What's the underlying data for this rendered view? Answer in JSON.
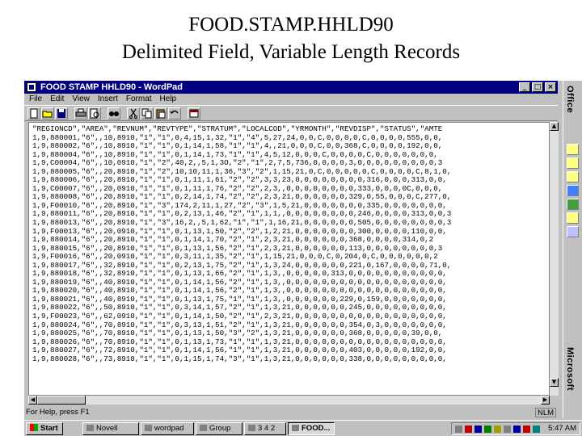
{
  "slide": {
    "title_line1": "FOOD.STAMP.HHLD90",
    "title_line2": "Delimited Field, Variable Length Records"
  },
  "window": {
    "title": "FOOD STAMP HHLD90 - WordPad",
    "minimize": "_",
    "maximize": "□",
    "close": "×"
  },
  "menu": [
    "File",
    "Edit",
    "View",
    "Insert",
    "Format",
    "Help"
  ],
  "toolbar_icons": [
    "new-icon",
    "open-icon",
    "save-icon",
    "print-icon",
    "print-preview-icon",
    "find-icon",
    "cut-icon",
    "copy-icon",
    "paste-icon",
    "undo-icon",
    "date-time-icon"
  ],
  "document_lines": [
    "\"REGIONCD\",\"AREA\",\"REVNUM\",\"REVTYPE\",\"STRATUM\",\"LOCALCOD\",\"YRMONTH\",\"REVDISP\",\"STATUS\",\"AMTE",
    "1,9,880001,\"6\",,10,8910,\"1\",\"1\",0,4,15,1,32,\"1\",\"4\",5,27,24,0,0,C,0,0,0,0,C,0,0,0,0,555,0,0,",
    "1,9,880002,\"6\",,10,8910,\"1\",\"1\",0,1,14,1,58,\"1\",\"1\",4,,21,0,0,0,C,0,0,368,C,0,0,0,0,192,0,0,",
    "1,9,880004,\"6\",,10,8910,\"1\",\"1\",0,1,14,1,73,\"1\",\"1\",4,5,12,0,0,0,C,0,0,0,0,C,0,0,0,0,0,0,0,",
    "1,9,C00004,\"6\",,10,0910,\"1\",\"2\",40,2,,5,1,3O,\"2\",\"1\",2,7,5,736,0,0,0,0,3,0,0,0,0,0,0,0,0,0,3",
    "1,9,880005,\"6\",,20,8910,\"1\",\"2\",10,10,11,1,36,\"3\",\"2\",1,15,21,0,C,0,0,0,0,0,C,0,0,0,0,C,8,1,0,",
    "1,9,880006,\"6\",,20,8910,\"1\",\"1\",0,1,11,1,61,\"2\",\"2\",3,3,23,0,0,0,0,0,0,0,0,316,0,0,0,313,0,0,",
    "1,9,C00007,\"6\",,20,0910,\"1\",\"1\",0,1,11,1,76,\"2\",\"2\",2,3,,0,0,0,0,0,0,0,0,333,0,0,0,0C,0,0,0,",
    "1,9,880008,\"6\",,20,8910,\"1\",\"1\",0,2,14,1,74,\"2\",\"2\",2,3,21,0,0,0,0,0,0,329,0,55,0,0,0,C,277,0,",
    "1,9,F00010,\"6\",,20,8910,\"1\",\"3\",174,2,11,1,27,\"2\",\"3\",1,5,21,0,0,0,0,0,0,0,335,0,0,0,0,0,0,0,",
    "1,9,880011,\"6\",,20,8910,\"1\",\"1\",0,2,13,1,46,\"2\",\"1\",1,1,,0,0,0,0,0,0,0,0,246,0,0,0,0,313,0,0,3",
    "1,9,880013,\"6\",,20,8910,\"1\",\"3\",16,2,,5,1,62,\"1\",\"1\",1,16,21,0,0,0,0,0,0,505,0,0,0,0,0,0,0,0,3",
    "1,9,F00013,\"6\",,20,0910,\"1\",\"1\",0,1,13,1,50,\"2\",\"2\",1,2,21,0,0,0,0,0,0,0,300,0,0,0,0,110,0,0,",
    "1,9,880014,\"6\",,20,8910,\"1\",\"1\",0,1,14,1,70,\"2\",\"1\",2,3,21,0,0,0,0,0,0,368,0,0,0,0,314,0,2",
    "1,9,880015,\"6\",,20,8910,\"1\",\"1\",0,1,13,1,56,\"2\",\"1\",2,3,21,0,0,0,0,0,0,113,0,0,0,0,0,0,0,0,3",
    "1,9,F00016,\"6\",,20,0910,\"1\",\"1\",0,3,11,1,35,\"2\",\"1\",1,15,21,0,0,0,C,0,204,0,C,0,0,0,0,0,0,2",
    "1,9,880017,\"6\",,32,8910,\"1\",\"1\",0,2,13,1,75,\"2\",\"1\",1,3,24,0,0,0,0,0,0,221,0,167,0,0,0,0,71,0,",
    "1,9,880018,\"6\",,32,8910,\"1\",\"1\",0,1,13,1,66,\"2\",\"1\",1,3,,0,0,0,0,0,313,0,0,0,0,0,0,0,0,0,0,0,",
    "1,9,880019,\"6\",,40,8910,\"1\",\"1\",0,1,14,1,56,\"2\",\"1\",1,3,,0,0,0,0,0,0,0,0,0,0,0,0,0,0,0,0,0,0,",
    "1,9,880020,\"6\",,40,8910,\"1\",\"1\",0,1,14,1,56,\"2\",\"1\",1,3,,0,0,0,0,0,0,0,0,0,0,0,0,0,0,0,0,0,0,",
    "1,9,880021,\"6\",,40,8910,\"1\",\"1\",0,1,13,1,75,\"1\",\"1\",1,3,,0,0,0,0,0,0,229,0,159,0,0,0,0,0,0,0,",
    "1,9,880022,\"6\",,50,8910,\"1\",\"1\",0,3,14,1,57,\"2\",\"1\",1,3,21,0,0,0,0,0,0,245,0,0,0,0,0,0,0,0,0,",
    "1,9,F00023,\"6\",,62,0910,\"1\",\"1\",0,1,14,1,50,\"2\",\"1\",2,3,21,0,0,0,0,0,0,0,0,0,0,0,0,0,0,0,0,0,",
    "1,9,880024,\"6\",,70,8910,\"1\",\"1\",0,3,13,1,51,\"2\",\"1\",1,3,21,0,0,0,0,0,0,354,0,3,0,0,0,0,0,0,0,",
    "1,9,880025,\"6\",,70,8910,\"1\",\"1\",0,1,13,1,50,\"3\",\"2\",1,3,21,0,0,0,0,0,0,368,0,0,0,0,0,39,0,0,",
    "1,9,880026,\"6\",,70,8910,\"1\",\"1\",0,1,13,1,73,\"1\",\"1\",1,3,21,0,0,0,0,0,0,0,0,0,0,0,0,0,0,0,0,0,",
    "1,9,880027,\"6\",,72,8910,\"1\",\"1\",0,1,14,1,56,\"1\",\"1\",1,3,21,0,0,0,0,0,0,403,0,0,0,0,0,192,0,0,",
    "1,9,880028,\"6\",,73,8910,\"1\",\"1\",0,1,15,1,74,\"3\",\"1\",1,3,21,0,0,0,0,0,0,338,0,0,0,0,0,0,0,0,0,"
  ],
  "status": {
    "help_text": "For Help, press F1",
    "indicator": "NLM"
  },
  "taskbar": {
    "start": "Start",
    "tasks": [
      "Novell",
      "wordpad",
      "Group",
      "3 4 2",
      "FOOD..."
    ],
    "clock": "5:47 AM"
  },
  "office_bar": {
    "top_label": "Office",
    "bottom_label": "Microsoft"
  }
}
